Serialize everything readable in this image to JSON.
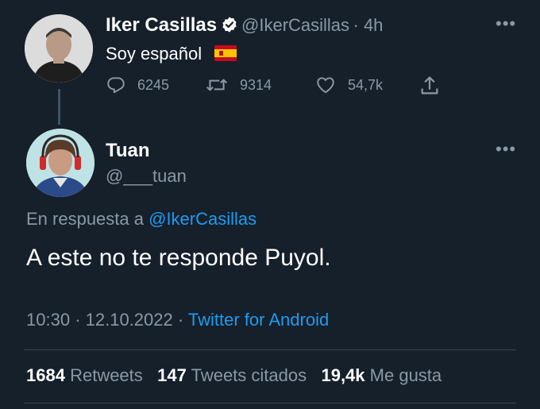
{
  "parent_tweet": {
    "author_name": "Iker Casillas",
    "handle": "@IkerCasillas",
    "time": "· 4h",
    "text": "Soy español",
    "verified_icon": "verified-badge-icon",
    "flag": "spain-flag",
    "actions": {
      "replies": "6245",
      "retweets": "9314",
      "likes": "54,7k"
    }
  },
  "reply_tweet": {
    "author_name": "Tuan",
    "handle": "@___tuan",
    "reply_prefix": "En respuesta a",
    "reply_to": "@IkerCasillas",
    "text": "A este no te responde Puyol.",
    "time": "10:30",
    "date": "· 12.10.2022 ·",
    "source": "Twitter for Android"
  },
  "stats": {
    "retweets_count": "1684",
    "retweets_label": "Retweets",
    "quotes_count": "147",
    "quotes_label": "Tweets citados",
    "likes_count": "19,4k",
    "likes_label": "Me gusta"
  },
  "colors": {
    "background": "#15202b",
    "muted": "#8b98a5",
    "link": "#1d9bf0",
    "verified": "#ffffff"
  }
}
